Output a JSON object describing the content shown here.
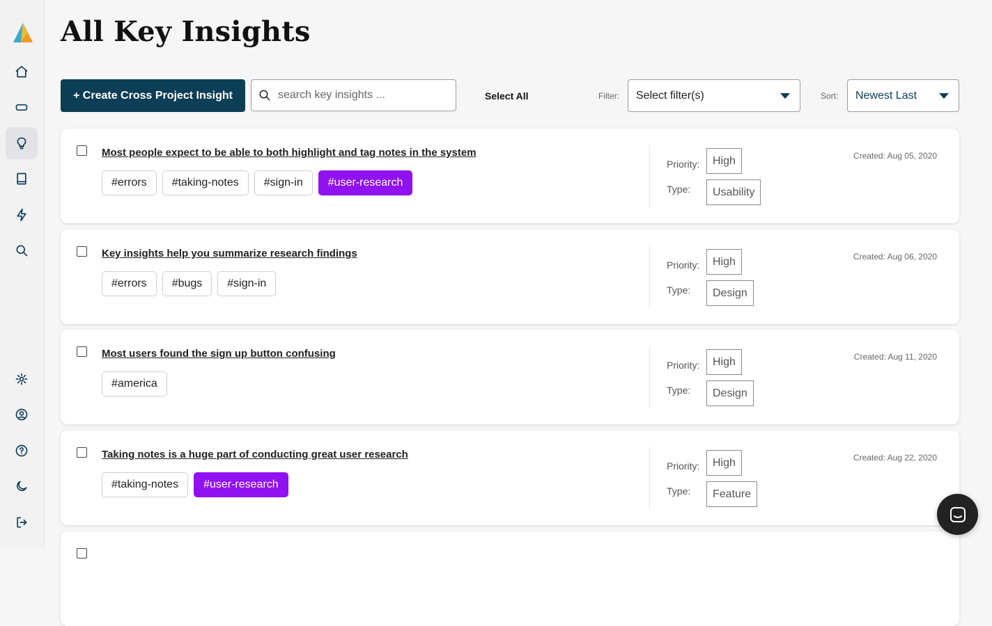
{
  "header": {
    "title": "All Key Insights"
  },
  "sidebar": {
    "items": [
      {
        "icon": "home-icon"
      },
      {
        "icon": "ticket-icon"
      },
      {
        "icon": "lightbulb-icon",
        "active": true
      },
      {
        "icon": "book-icon"
      },
      {
        "icon": "lightning-icon"
      },
      {
        "icon": "search-icon"
      },
      {
        "icon": "gear-icon"
      },
      {
        "icon": "user-circle-icon"
      },
      {
        "icon": "help-icon"
      },
      {
        "icon": "moon-icon"
      },
      {
        "icon": "logout-icon"
      }
    ]
  },
  "toolbar": {
    "create_label": "+ Create Cross Project Insight",
    "search_placeholder": "search key insights ...",
    "select_all_label": "Select All",
    "filter_label": "Filter:",
    "filter_value": "Select filter(s)",
    "sort_label": "Sort:",
    "sort_value": "Newest Last"
  },
  "labels": {
    "priority": "Priority:",
    "type": "Type:"
  },
  "insights": [
    {
      "title": "Most people expect to be able to both highlight and tag notes in the system",
      "tags": [
        {
          "text": "#errors",
          "highlighted": false
        },
        {
          "text": "#taking-notes",
          "highlighted": false
        },
        {
          "text": "#sign-in",
          "highlighted": false
        },
        {
          "text": "#user-research",
          "highlighted": true
        }
      ],
      "priority": "High",
      "type": "Usability",
      "created": "Created: Aug 05, 2020"
    },
    {
      "title": "Key insights help you summarize research findings",
      "tags": [
        {
          "text": "#errors",
          "highlighted": false
        },
        {
          "text": "#bugs",
          "highlighted": false
        },
        {
          "text": "#sign-in",
          "highlighted": false
        }
      ],
      "priority": "High",
      "type": "Design",
      "created": "Created: Aug 06, 2020"
    },
    {
      "title": "Most users found the sign up button confusing",
      "tags": [
        {
          "text": "#america",
          "highlighted": false
        }
      ],
      "priority": "High",
      "type": "Design",
      "created": "Created: Aug 11, 2020"
    },
    {
      "title": "Taking notes is a huge part of conducting great user research",
      "tags": [
        {
          "text": "#taking-notes",
          "highlighted": false
        },
        {
          "text": "#user-research",
          "highlighted": true
        }
      ],
      "priority": "High",
      "type": "Feature",
      "created": "Created: Aug 22, 2020"
    }
  ],
  "colors": {
    "accent": "#0c3e55",
    "tag_highlight": "#9012f0",
    "background": "#f6f6f7"
  }
}
